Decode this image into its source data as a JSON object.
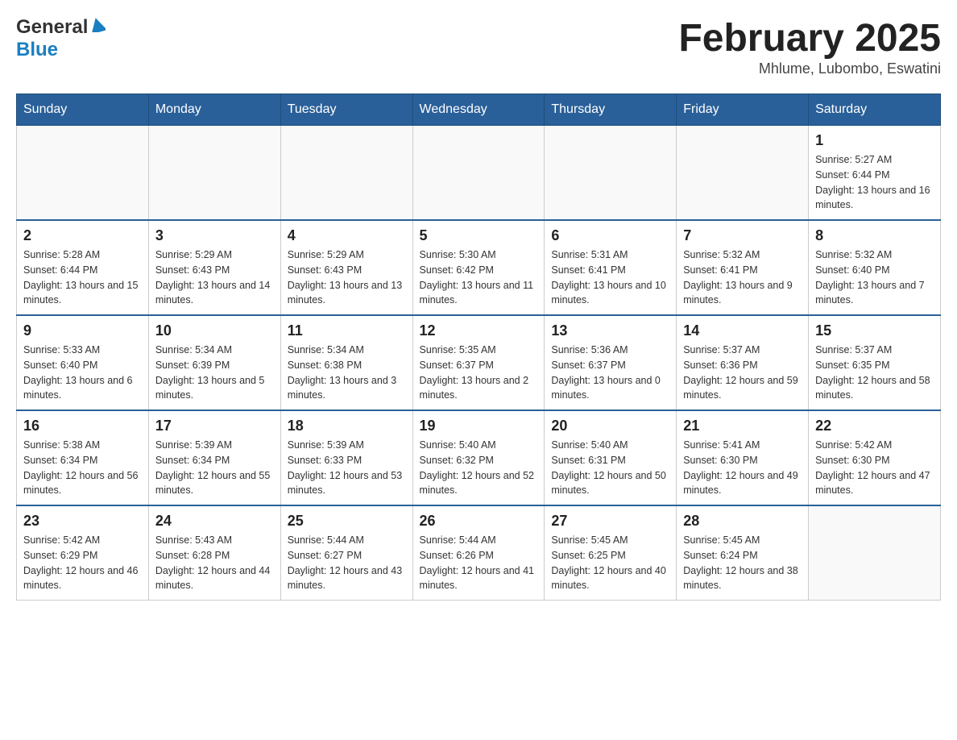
{
  "header": {
    "logo_general": "General",
    "logo_blue": "Blue",
    "month_title": "February 2025",
    "location": "Mhlume, Lubombo, Eswatini"
  },
  "days_of_week": [
    "Sunday",
    "Monday",
    "Tuesday",
    "Wednesday",
    "Thursday",
    "Friday",
    "Saturday"
  ],
  "weeks": [
    [
      {
        "day": "",
        "info": ""
      },
      {
        "day": "",
        "info": ""
      },
      {
        "day": "",
        "info": ""
      },
      {
        "day": "",
        "info": ""
      },
      {
        "day": "",
        "info": ""
      },
      {
        "day": "",
        "info": ""
      },
      {
        "day": "1",
        "info": "Sunrise: 5:27 AM\nSunset: 6:44 PM\nDaylight: 13 hours and 16 minutes."
      }
    ],
    [
      {
        "day": "2",
        "info": "Sunrise: 5:28 AM\nSunset: 6:44 PM\nDaylight: 13 hours and 15 minutes."
      },
      {
        "day": "3",
        "info": "Sunrise: 5:29 AM\nSunset: 6:43 PM\nDaylight: 13 hours and 14 minutes."
      },
      {
        "day": "4",
        "info": "Sunrise: 5:29 AM\nSunset: 6:43 PM\nDaylight: 13 hours and 13 minutes."
      },
      {
        "day": "5",
        "info": "Sunrise: 5:30 AM\nSunset: 6:42 PM\nDaylight: 13 hours and 11 minutes."
      },
      {
        "day": "6",
        "info": "Sunrise: 5:31 AM\nSunset: 6:41 PM\nDaylight: 13 hours and 10 minutes."
      },
      {
        "day": "7",
        "info": "Sunrise: 5:32 AM\nSunset: 6:41 PM\nDaylight: 13 hours and 9 minutes."
      },
      {
        "day": "8",
        "info": "Sunrise: 5:32 AM\nSunset: 6:40 PM\nDaylight: 13 hours and 7 minutes."
      }
    ],
    [
      {
        "day": "9",
        "info": "Sunrise: 5:33 AM\nSunset: 6:40 PM\nDaylight: 13 hours and 6 minutes."
      },
      {
        "day": "10",
        "info": "Sunrise: 5:34 AM\nSunset: 6:39 PM\nDaylight: 13 hours and 5 minutes."
      },
      {
        "day": "11",
        "info": "Sunrise: 5:34 AM\nSunset: 6:38 PM\nDaylight: 13 hours and 3 minutes."
      },
      {
        "day": "12",
        "info": "Sunrise: 5:35 AM\nSunset: 6:37 PM\nDaylight: 13 hours and 2 minutes."
      },
      {
        "day": "13",
        "info": "Sunrise: 5:36 AM\nSunset: 6:37 PM\nDaylight: 13 hours and 0 minutes."
      },
      {
        "day": "14",
        "info": "Sunrise: 5:37 AM\nSunset: 6:36 PM\nDaylight: 12 hours and 59 minutes."
      },
      {
        "day": "15",
        "info": "Sunrise: 5:37 AM\nSunset: 6:35 PM\nDaylight: 12 hours and 58 minutes."
      }
    ],
    [
      {
        "day": "16",
        "info": "Sunrise: 5:38 AM\nSunset: 6:34 PM\nDaylight: 12 hours and 56 minutes."
      },
      {
        "day": "17",
        "info": "Sunrise: 5:39 AM\nSunset: 6:34 PM\nDaylight: 12 hours and 55 minutes."
      },
      {
        "day": "18",
        "info": "Sunrise: 5:39 AM\nSunset: 6:33 PM\nDaylight: 12 hours and 53 minutes."
      },
      {
        "day": "19",
        "info": "Sunrise: 5:40 AM\nSunset: 6:32 PM\nDaylight: 12 hours and 52 minutes."
      },
      {
        "day": "20",
        "info": "Sunrise: 5:40 AM\nSunset: 6:31 PM\nDaylight: 12 hours and 50 minutes."
      },
      {
        "day": "21",
        "info": "Sunrise: 5:41 AM\nSunset: 6:30 PM\nDaylight: 12 hours and 49 minutes."
      },
      {
        "day": "22",
        "info": "Sunrise: 5:42 AM\nSunset: 6:30 PM\nDaylight: 12 hours and 47 minutes."
      }
    ],
    [
      {
        "day": "23",
        "info": "Sunrise: 5:42 AM\nSunset: 6:29 PM\nDaylight: 12 hours and 46 minutes."
      },
      {
        "day": "24",
        "info": "Sunrise: 5:43 AM\nSunset: 6:28 PM\nDaylight: 12 hours and 44 minutes."
      },
      {
        "day": "25",
        "info": "Sunrise: 5:44 AM\nSunset: 6:27 PM\nDaylight: 12 hours and 43 minutes."
      },
      {
        "day": "26",
        "info": "Sunrise: 5:44 AM\nSunset: 6:26 PM\nDaylight: 12 hours and 41 minutes."
      },
      {
        "day": "27",
        "info": "Sunrise: 5:45 AM\nSunset: 6:25 PM\nDaylight: 12 hours and 40 minutes."
      },
      {
        "day": "28",
        "info": "Sunrise: 5:45 AM\nSunset: 6:24 PM\nDaylight: 12 hours and 38 minutes."
      },
      {
        "day": "",
        "info": ""
      }
    ]
  ]
}
